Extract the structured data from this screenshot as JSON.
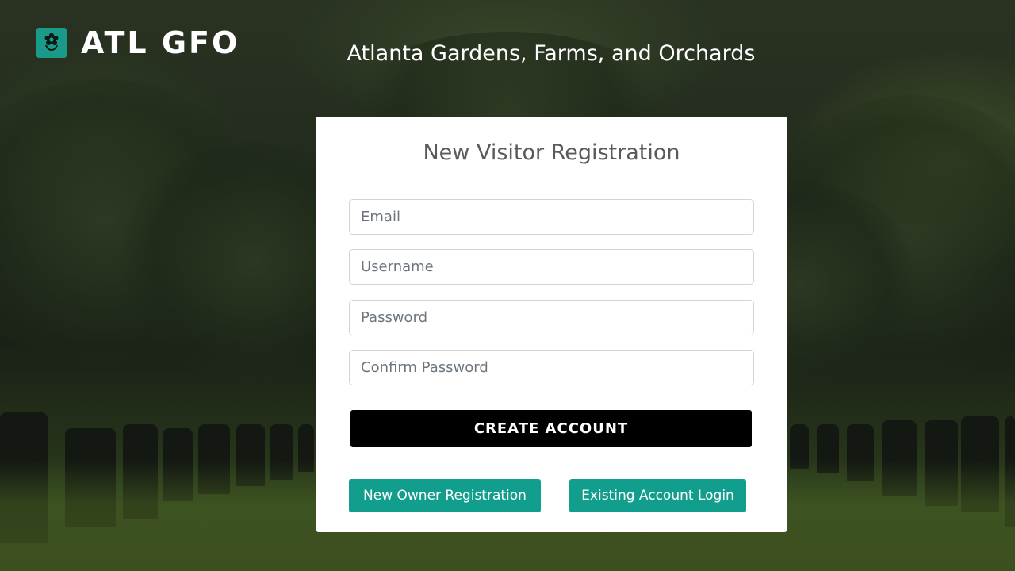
{
  "brand": {
    "name": "ATL GFO",
    "tagline": "Atlanta Gardens, Farms, and Orchards",
    "logo_icon": "flower-icon"
  },
  "form": {
    "title": "New Visitor Registration",
    "email_placeholder": "Email",
    "username_placeholder": "Username",
    "password_placeholder": "Password",
    "confirm_password_placeholder": "Confirm Password",
    "create_label": "CREATE ACCOUNT",
    "owner_registration_label": "New Owner Registration",
    "existing_login_label": "Existing Account Login"
  },
  "colors": {
    "accent": "#129e8c",
    "primary_button": "#000000"
  }
}
